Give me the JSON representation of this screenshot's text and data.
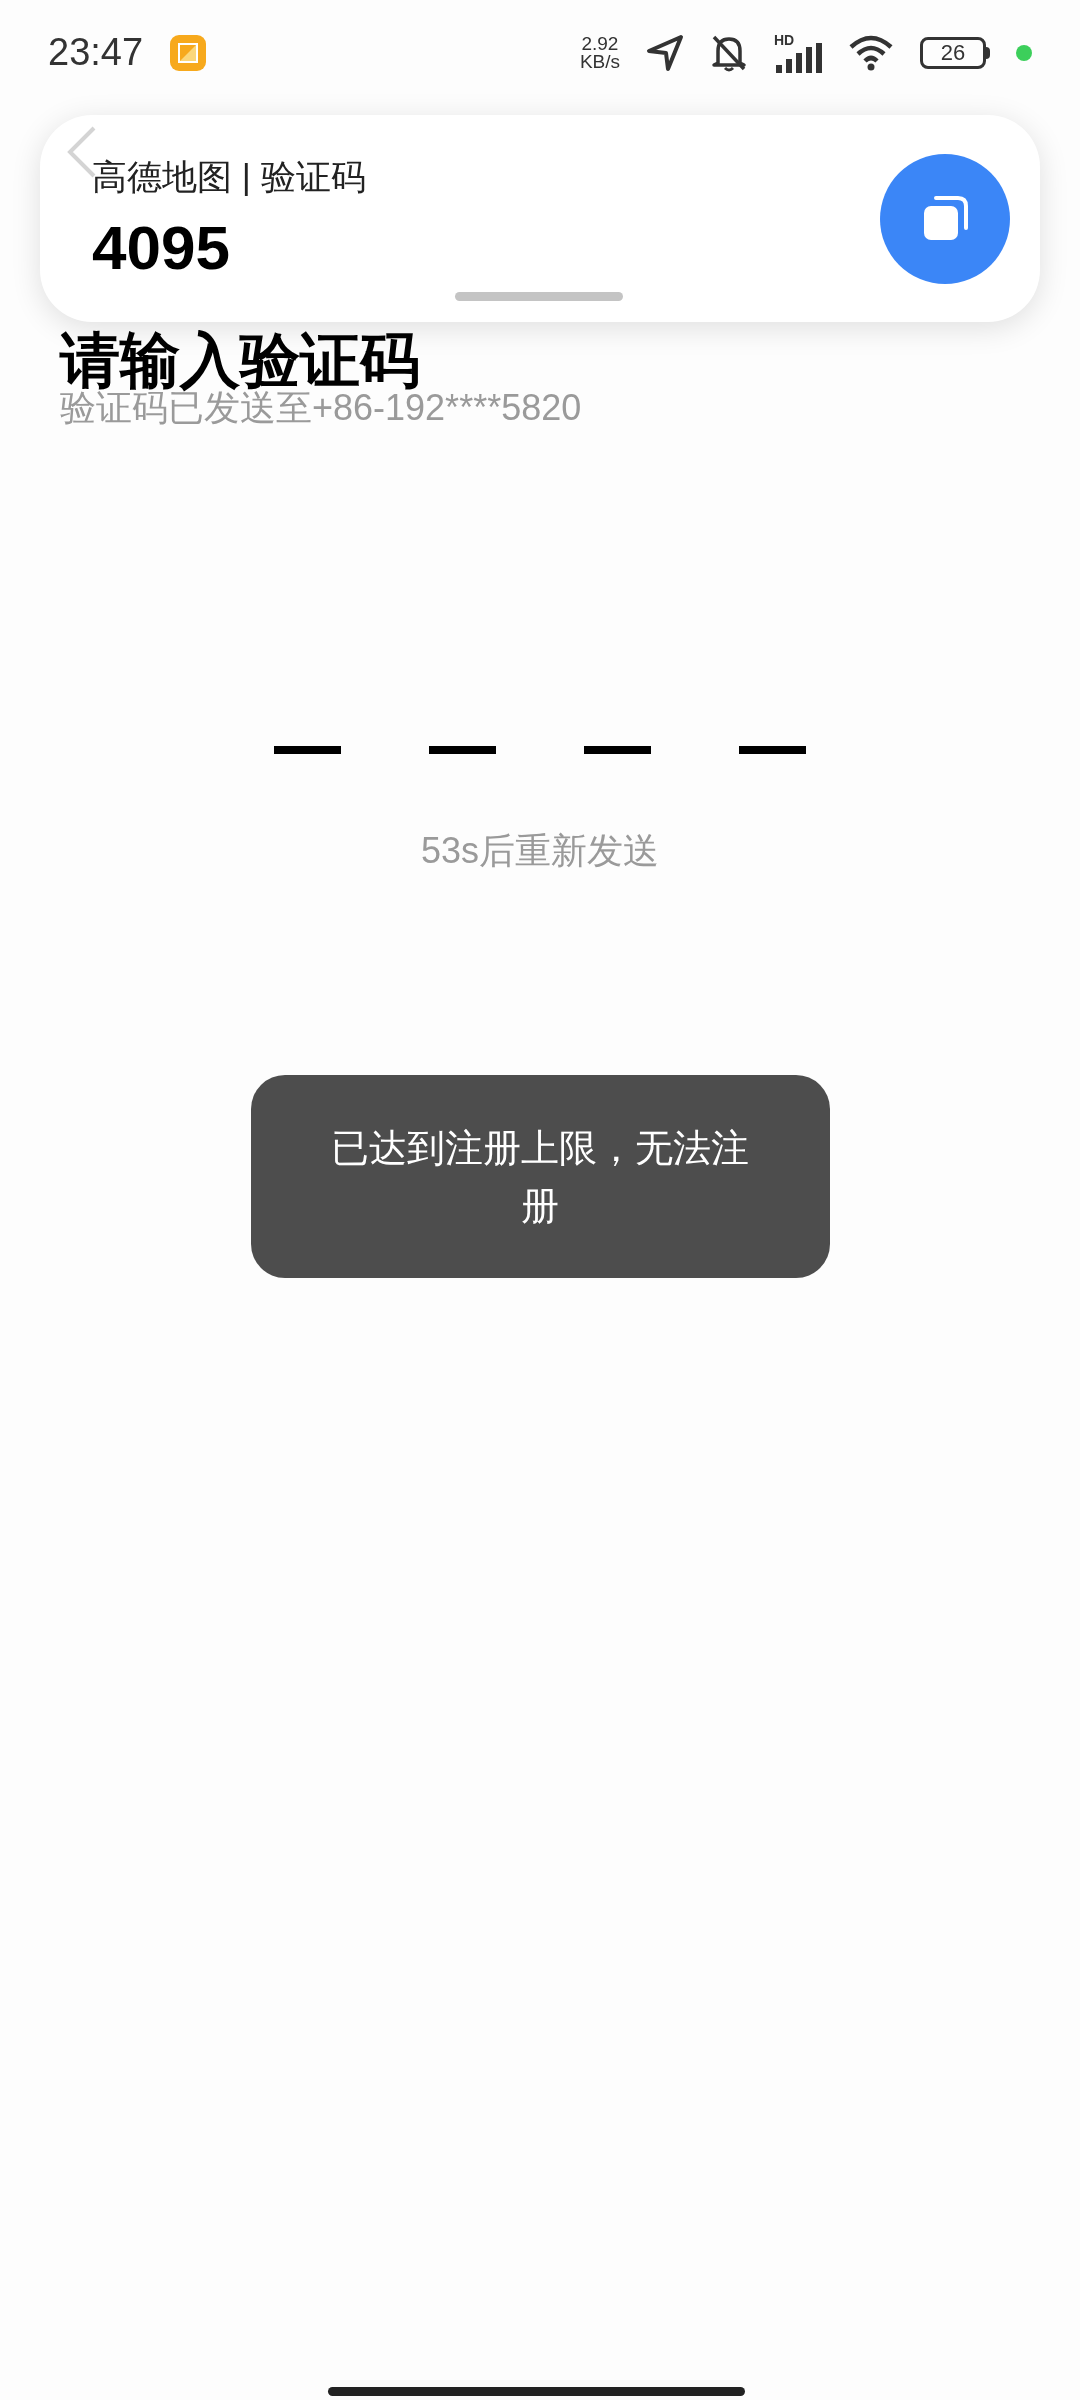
{
  "status_bar": {
    "time": "23:47",
    "net_speed": [
      "2.92",
      "KB/s"
    ],
    "signal_label": "HD",
    "battery": "26"
  },
  "notification": {
    "title": "高德地图 | 验证码",
    "code": "4095"
  },
  "page": {
    "title": "请输入验证码",
    "subtitle": "验证码已发送至+86-192****5820",
    "code_slots": [
      {
        "filled": false
      },
      {
        "filled": false
      },
      {
        "filled": false
      },
      {
        "filled": false
      }
    ],
    "resend": "53s后重新发送"
  },
  "toast": "已达到注册上限，无法注册"
}
